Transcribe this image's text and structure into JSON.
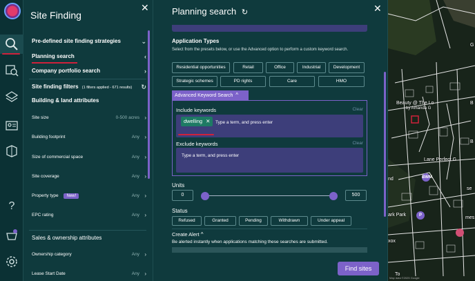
{
  "site_finding": {
    "title": "Site Finding",
    "predefined": "Pre-defined site finding strategies",
    "planning_search": "Planning search",
    "company_portfolio": "Company portfolio search",
    "filters_label": "Site finding filters",
    "filters_meta": "(1 filters applied - 671 results)",
    "building_land": "Building & land attributes",
    "items": [
      {
        "label": "Site size",
        "value": "0-500 acres"
      },
      {
        "label": "Building footprint",
        "value": "Any"
      },
      {
        "label": "Size of commercial space",
        "value": "Any"
      },
      {
        "label": "Site coverage",
        "value": "Any"
      },
      {
        "label": "Property type",
        "value": "Any",
        "badge": "New!"
      },
      {
        "label": "EPC rating",
        "value": "Any"
      }
    ],
    "sales_ownership": "Sales & ownership attributes",
    "items2": [
      {
        "label": "Ownership category",
        "value": "Any"
      },
      {
        "label": "Lease Start Date",
        "value": "Any"
      }
    ]
  },
  "planning": {
    "title": "Planning search",
    "application_types": "Application Types",
    "instructions": "Select from the presets below, or use the Advanced option to perform a custom keyword search.",
    "presets": [
      "Residential opportunities",
      "Retail",
      "Office",
      "Industrial",
      "Development",
      "Strategic schemes",
      "PD rights",
      "Care",
      "HMO"
    ],
    "advanced_tab": "Advanced Keyword Search",
    "include_label": "Include keywords",
    "include_clear": "Clear",
    "include_chip": "dwelling",
    "include_placeholder": "Type a term, and press enter",
    "exclude_label": "Exclude keywords",
    "exclude_clear": "Clear",
    "exclude_placeholder": "Type a term, and press enter",
    "units_label": "Units",
    "units_min": "0",
    "units_max": "500",
    "status_label": "Status",
    "statuses": [
      "Refused",
      "Granted",
      "Pending",
      "Withdrawn",
      "Under appeal"
    ],
    "create_alert": "Create Alert",
    "alert_text": "Be alerted instantly when applications matching these searches are submitted.",
    "find_sites": "Find sites"
  },
  "map": {
    "label_beauty": "Beauty @ The Lo",
    "label_by": "by Amanda G",
    "label_lane": "Lane Perfect G",
    "label_park": "ark Park",
    "label_nd": "nd",
    "label_to": "To",
    "label_xox": "xox",
    "label_g": "G",
    "label_b1": "B",
    "label_b2": "B",
    "label_se": "se",
    "label_mes": "mes",
    "pin_bwm": "BWM",
    "pin_p": "P",
    "copyright": "Map data ©2025 Google"
  },
  "colors": {
    "panel": "#0f3a3d",
    "accent": "#7c62c9",
    "input": "#3d3e7a",
    "chip_green": "#1e7a64",
    "annotation_red": "#d0213b"
  }
}
